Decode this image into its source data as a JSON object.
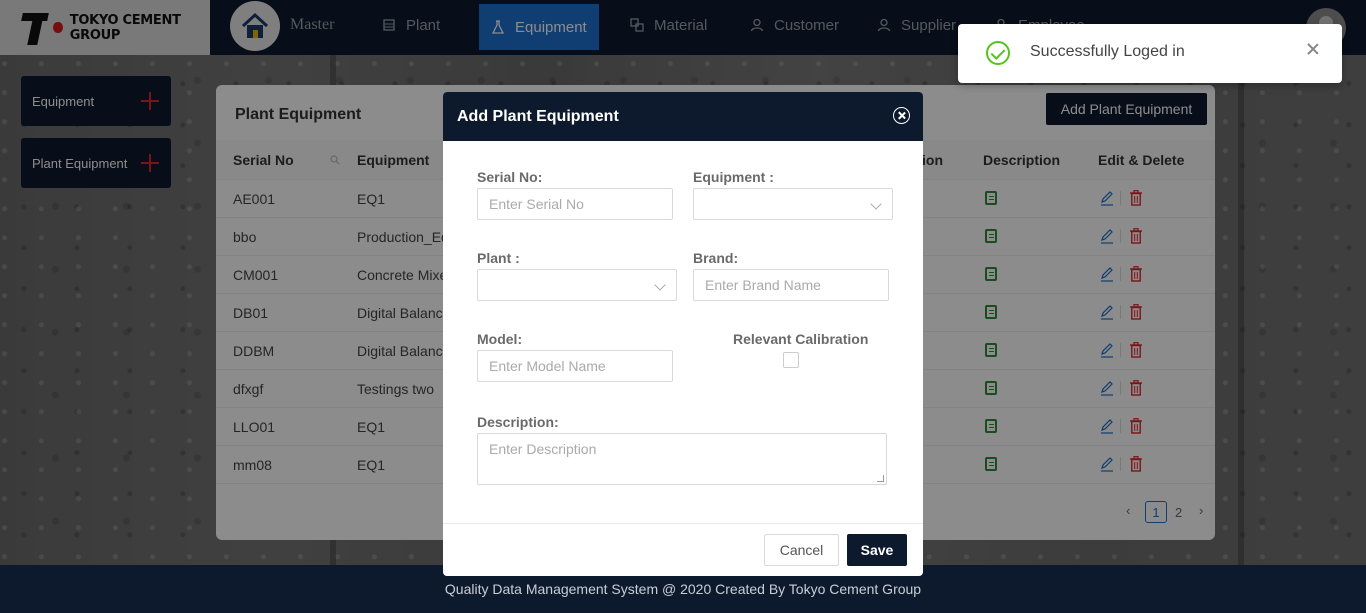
{
  "brand": {
    "name": "TOKYO CEMENT GROUP",
    "red": "#d81b1b"
  },
  "nav": {
    "master": "Master",
    "items": [
      {
        "label": "Plant",
        "icon": "building-icon"
      },
      {
        "label": "Equipment",
        "icon": "flask-icon",
        "active": true
      },
      {
        "label": "Material",
        "icon": "blocks-icon"
      },
      {
        "label": "Customer",
        "icon": "user-icon"
      },
      {
        "label": "Supplier",
        "icon": "user-icon"
      },
      {
        "label": "Employee",
        "icon": "user-icon"
      }
    ]
  },
  "sidebar": {
    "items": [
      {
        "label": "Equipment"
      },
      {
        "label": "Plant Equipment"
      }
    ]
  },
  "card": {
    "title": "Plant Equipment",
    "add_button": "Add Plant Equipment",
    "columns": [
      "Serial No",
      "Equipment",
      "Relevant Calibration",
      "Description",
      "Edit & Delete"
    ],
    "visible_column_fragments": {
      "calibration": "ion"
    },
    "rows": [
      {
        "serial": "AE001",
        "equipment": "EQ1"
      },
      {
        "serial": "bbo",
        "equipment": "Production_Eq"
      },
      {
        "serial": "CM001",
        "equipment": "Concrete Mixer"
      },
      {
        "serial": "DB01",
        "equipment": "Digital Balance"
      },
      {
        "serial": "DDBM",
        "equipment": "Digital Balance"
      },
      {
        "serial": "dfxgf",
        "equipment": "Testings two"
      },
      {
        "serial": "LLO01",
        "equipment": "EQ1"
      },
      {
        "serial": "mm08",
        "equipment": "EQ1"
      }
    ],
    "pagination": {
      "current": "1",
      "next": "2"
    }
  },
  "modal": {
    "title": "Add Plant Equipment",
    "serial_label": "Serial No:",
    "serial_placeholder": "Enter Serial No",
    "equipment_label": "Equipment :",
    "plant_label": "Plant :",
    "brand_label": "Brand:",
    "brand_placeholder": "Enter Brand Name",
    "model_label": "Model:",
    "model_placeholder": "Enter Model Name",
    "calibration_label": "Relevant Calibration",
    "description_label": "Description:",
    "description_placeholder": "Enter Description",
    "cancel": "Cancel",
    "save": "Save"
  },
  "toast": {
    "message": "Successfully Loged in"
  },
  "footer": {
    "text": "Quality Data Management System @ 2020 Created By Tokyo Cement Group"
  },
  "colors": {
    "navy": "#0d1a2e",
    "accent": "#1e6fd0",
    "success": "#52c41a",
    "danger": "#e0262b"
  }
}
